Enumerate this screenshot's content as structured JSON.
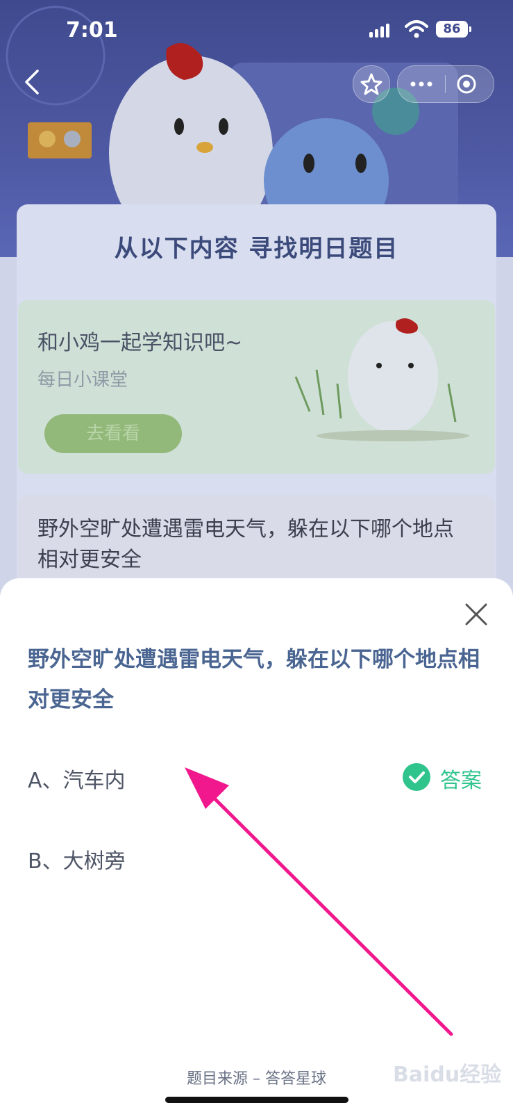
{
  "status_bar": {
    "time": "7:01",
    "battery": "86"
  },
  "header": {
    "section_title": "从以下内容 寻找明日题目"
  },
  "lesson": {
    "title": "和小鸡一起学知识吧~",
    "subtitle": "每日小课堂",
    "button": "去看看"
  },
  "question_card": {
    "text": "野外空旷处遭遇雷电天气，躲在以下哪个地点相对更安全"
  },
  "sheet": {
    "question": "野外空旷处遭遇雷电天气，躲在以下哪个地点相对更安全",
    "options": [
      {
        "label": "A、汽车内",
        "is_answer": true
      },
      {
        "label": "B、大树旁",
        "is_answer": false
      }
    ],
    "answer_label": "答案",
    "source": "题目来源 – 答答星球"
  },
  "colors": {
    "answer": "#2fc48c",
    "question": "#4a6591",
    "arrow": "#f0188c"
  },
  "watermark": "Baidu经验"
}
